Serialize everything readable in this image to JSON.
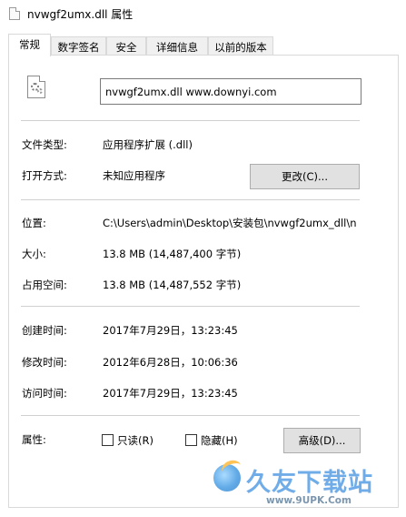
{
  "window": {
    "title": "nvwgf2umx.dll 属性"
  },
  "tabs": [
    {
      "label": "常规",
      "active": true
    },
    {
      "label": "数字签名",
      "active": false
    },
    {
      "label": "安全",
      "active": false
    },
    {
      "label": "详细信息",
      "active": false
    },
    {
      "label": "以前的版本",
      "active": false
    }
  ],
  "general": {
    "filename": "nvwgf2umx.dll www.downyi.com",
    "file_type": {
      "label": "文件类型:",
      "value": "应用程序扩展 (.dll)"
    },
    "opens_with": {
      "label": "打开方式:",
      "value": "未知应用程序",
      "change_button": "更改(C)..."
    },
    "location": {
      "label": "位置:",
      "value": "C:\\Users\\admin\\Desktop\\安装包\\nvwgf2umx_dll\\n"
    },
    "size": {
      "label": "大小:",
      "value": "13.8 MB (14,487,400 字节)"
    },
    "size_on_disk": {
      "label": "占用空间:",
      "value": "13.8 MB (14,487,552 字节)"
    },
    "created": {
      "label": "创建时间:",
      "value": "2017年7月29日，13:23:45"
    },
    "modified": {
      "label": "修改时间:",
      "value": "2012年6月28日，10:06:36"
    },
    "accessed": {
      "label": "访问时间:",
      "value": "2017年7月29日，13:23:45"
    },
    "attributes": {
      "label": "属性:",
      "readonly": {
        "label": "只读(R)",
        "checked": false
      },
      "hidden": {
        "label": "隐藏(H)",
        "checked": false
      },
      "advanced_button": "高级(D)..."
    }
  },
  "watermark": {
    "brand": "久友下载站",
    "url": "www.9UPK.Com"
  },
  "colors": {
    "focus_border": "#0078d7",
    "button_bg": "#e1e1e1",
    "tab_inactive_bg": "#f0f0f0"
  },
  "icons": {
    "window": "dll-file-icon",
    "file": "dll-gear-file-icon"
  }
}
